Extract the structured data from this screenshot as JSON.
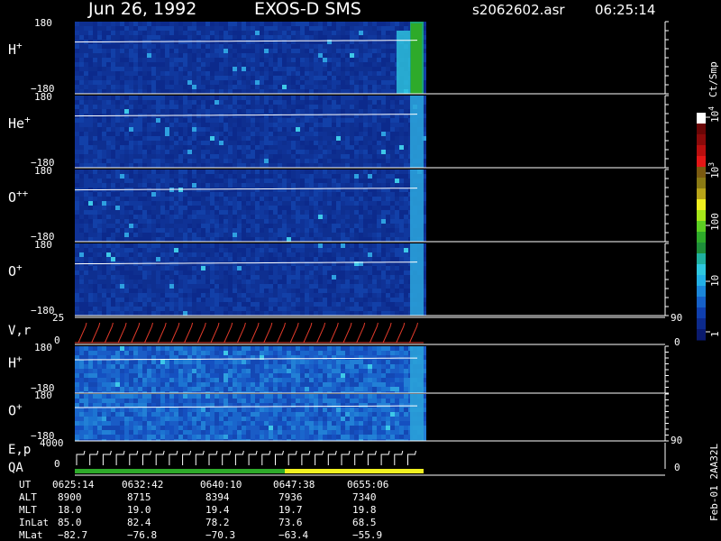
{
  "header": {
    "date": "Jun 26, 1992",
    "instrument": "EXOS-D SMS",
    "file": "s2062602.asr",
    "time": "06:25:14"
  },
  "colorbar": {
    "unit": "Ct/Smp",
    "ticks": [
      "1",
      "10",
      "100",
      "10",
      "10"
    ],
    "tick_exponents": [
      "",
      "",
      "",
      "3",
      "4"
    ],
    "colors": [
      "#0a1a6e",
      "#0c2a8c",
      "#0f3fae",
      "#1560c8",
      "#1a86da",
      "#22b0e6",
      "#2ec8e0",
      "#1fb0a0",
      "#1e8e3a",
      "#2eaa2a",
      "#5ccf22",
      "#a6e61a",
      "#f0f020",
      "#b8a418",
      "#8a7a14",
      "#7a5a10",
      "#e31616",
      "#b80e0e",
      "#8a0a0a",
      "#6a0606",
      "#ffffff"
    ]
  },
  "footer_code": "Feb-01 2AA32L",
  "panels": [
    {
      "label": "H",
      "sup": "+",
      "ytop": "180",
      "ybot": "−180",
      "variant": "h"
    },
    {
      "label": "He",
      "sup": "+",
      "ytop": "180",
      "ybot": "−180",
      "variant": "dim"
    },
    {
      "label": "O",
      "sup": "++",
      "ytop": "180",
      "ybot": "−180",
      "variant": "dim"
    },
    {
      "label": "O",
      "sup": "+",
      "ytop": "180",
      "ybot": "−180",
      "variant": "dim"
    }
  ],
  "lower_panels": [
    {
      "label": "H",
      "sup": "+",
      "ytop": "180",
      "ybot": "−180",
      "variant": "bright"
    },
    {
      "label": "O",
      "sup": "+",
      "ytop": "180",
      "ybot": "−180",
      "variant": "bright"
    }
  ],
  "vr": {
    "label": "V,r",
    "ytop": "25",
    "ybot": "0",
    "right_top": "90",
    "right_bot": "0"
  },
  "ep": {
    "label_top": "E,p",
    "label_bot": "QA",
    "ytop": "4000",
    "ybot": "0",
    "right_top": "90",
    "right_bot": "0"
  },
  "chart_data": {
    "type": "heatmap",
    "x_start": "06:25:14",
    "x_end": "06:57:00",
    "y_range": [
      -180,
      180
    ],
    "ephemeris": {
      "rows": [
        "UT",
        "ALT",
        "MLT",
        "InLat",
        "MLat"
      ],
      "columns": [
        [
          "0625:14",
          "8900",
          "18.0",
          "85.0",
          "−82.7"
        ],
        [
          "0632:42",
          "8715",
          "19.0",
          "82.4",
          "−76.8"
        ],
        [
          "0640:10",
          "8394",
          "19.4",
          "78.2",
          "−70.3"
        ],
        [
          "0647:38",
          "7936",
          "19.7",
          "73.6",
          "−63.4"
        ],
        [
          "0655:06",
          "7340",
          "19.8",
          "68.5",
          "−55.9"
        ]
      ]
    }
  }
}
